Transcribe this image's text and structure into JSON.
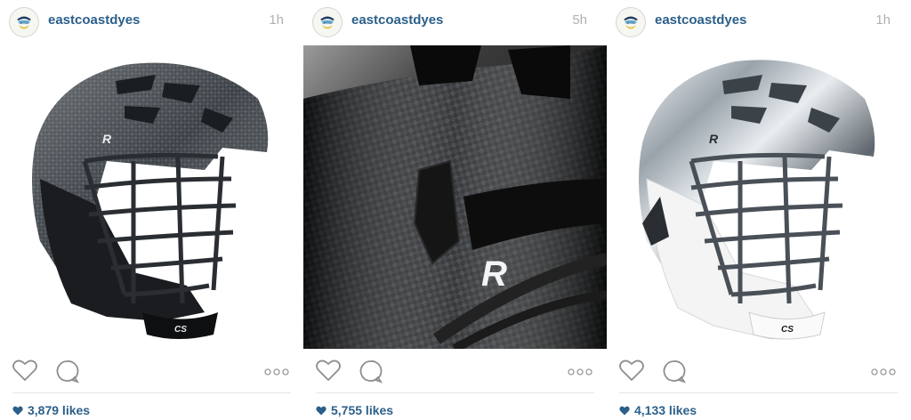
{
  "posts": [
    {
      "username": "eastcoastdyes",
      "time": "1h",
      "likes": "3,879 likes",
      "photo": "carbon-fiber-lacrosse-helmet",
      "accent": "#2b5f8a"
    },
    {
      "username": "eastcoastdyes",
      "time": "5h",
      "likes": "5,755 likes",
      "photo": "carbon-fiber-helmet-closeup",
      "accent": "#2b5f8a"
    },
    {
      "username": "eastcoastdyes",
      "time": "1h",
      "likes": "4,133 likes",
      "photo": "chrome-lacrosse-helmet",
      "accent": "#2b5f8a"
    }
  ],
  "icons": {
    "like": "heart-icon",
    "comment": "comment-icon",
    "more": "more-options-icon",
    "avatar": "eastcoastdyes-logo-avatar"
  },
  "colors": {
    "username": "#2b5f8a",
    "timestamp": "#b0b0b0",
    "divider": "#e6e6e6"
  }
}
